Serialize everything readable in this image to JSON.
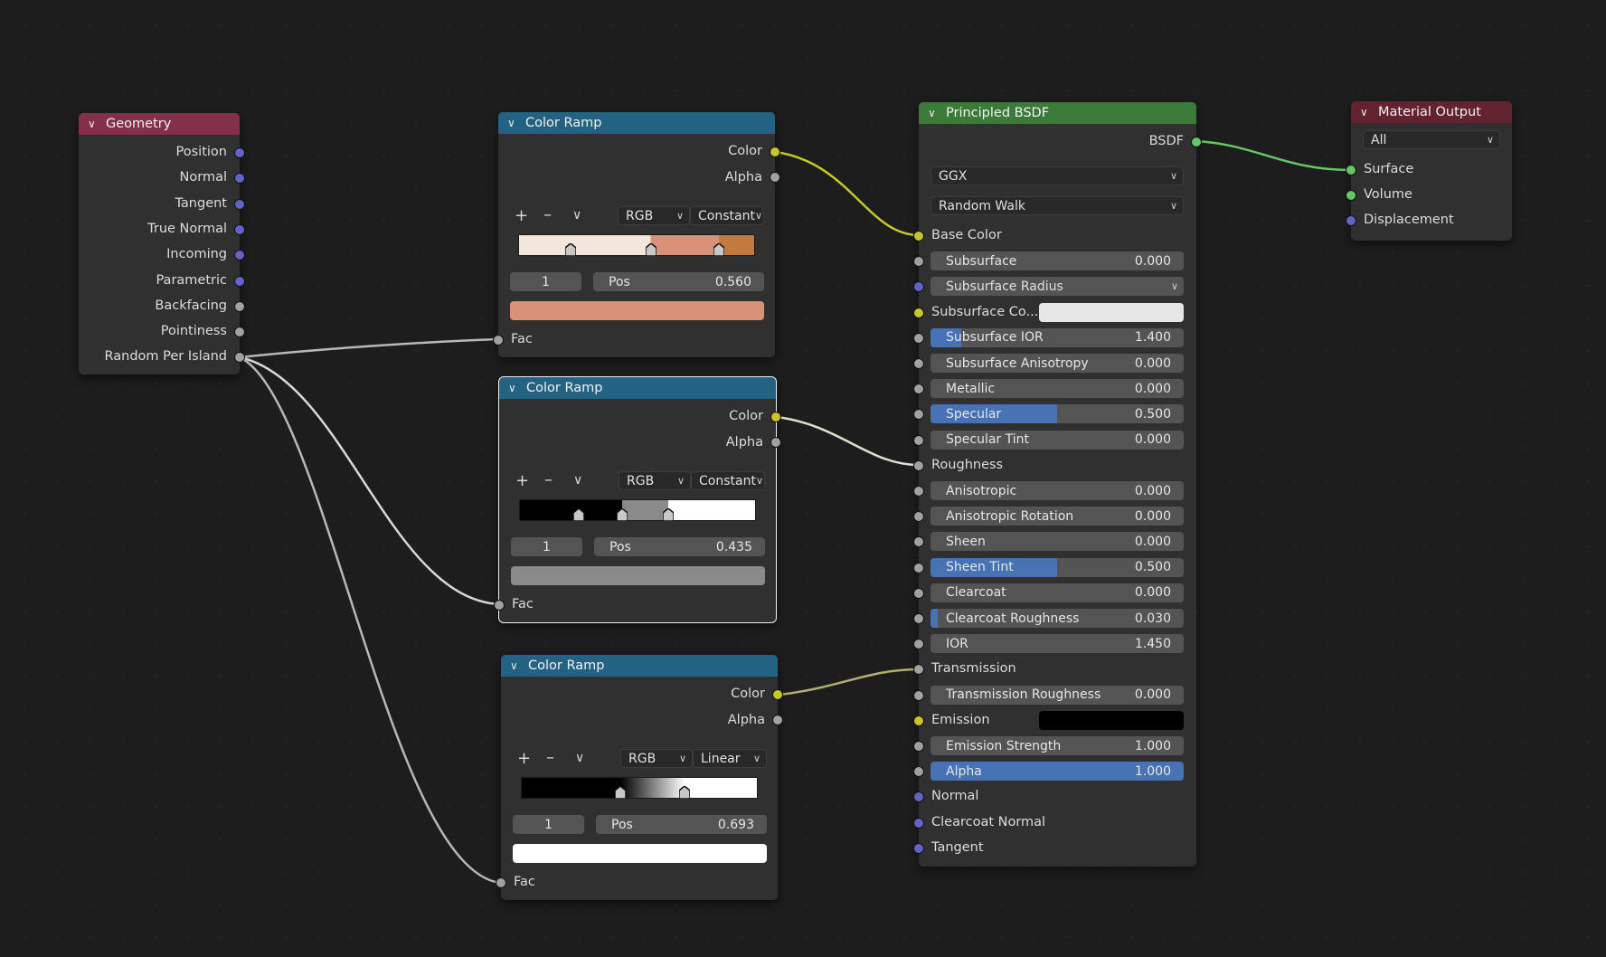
{
  "colors": {
    "socket_vector": "#6363c7",
    "socket_float": "#a1a1a1",
    "socket_color": "#c7c729",
    "socket_shader": "#63c763",
    "slider_fill": "#4772b3"
  },
  "geometry": {
    "title": "Geometry",
    "outputs": [
      "Position",
      "Normal",
      "Tangent",
      "True Normal",
      "Incoming",
      "Parametric",
      "Backfacing",
      "Pointiness",
      "Random Per Island"
    ]
  },
  "ramp1": {
    "title": "Color Ramp",
    "out_color": "Color",
    "out_alpha": "Alpha",
    "mode": "RGB",
    "interp": "Constant",
    "index": "1",
    "pos_label": "Pos",
    "pos": "0.560",
    "swatch": "#d9917a",
    "stops": [
      0.22,
      0.56,
      0.85
    ],
    "segments": [
      "#f3e6da",
      "#d9917a",
      "#c47a3f"
    ],
    "in_fac": "Fac"
  },
  "ramp2": {
    "title": "Color Ramp",
    "out_color": "Color",
    "out_alpha": "Alpha",
    "mode": "RGB",
    "interp": "Constant",
    "index": "1",
    "pos_label": "Pos",
    "pos": "0.435",
    "swatch": "#8a8a8a",
    "stops": [
      0.25,
      0.435,
      0.63
    ],
    "segments": [
      "#000000",
      "#8a8a8a",
      "#ffffff"
    ],
    "in_fac": "Fac"
  },
  "ramp3": {
    "title": "Color Ramp",
    "out_color": "Color",
    "out_alpha": "Alpha",
    "mode": "RGB",
    "interp": "Linear",
    "index": "1",
    "pos_label": "Pos",
    "pos": "0.693",
    "swatch": "#ffffff",
    "stops": [
      0.42,
      0.693
    ],
    "in_fac": "Fac"
  },
  "bsdf": {
    "title": "Principled BSDF",
    "out": "BSDF",
    "distribution": "GGX",
    "subsurface_method": "Random Walk",
    "base_color": "Base Color",
    "subsurface": {
      "label": "Subsurface",
      "value": "0.000",
      "fill": 0
    },
    "subsurface_radius": "Subsurface Radius",
    "subsurface_color": "Subsurface Co...",
    "subsurface_ior": {
      "label": "Subsurface IOR",
      "value": "1.400",
      "fill": 0.12
    },
    "subsurface_aniso": {
      "label": "Subsurface Anisotropy",
      "value": "0.000",
      "fill": 0
    },
    "metallic": {
      "label": "Metallic",
      "value": "0.000",
      "fill": 0
    },
    "specular": {
      "label": "Specular",
      "value": "0.500",
      "fill": 0.5
    },
    "specular_tint": {
      "label": "Specular Tint",
      "value": "0.000",
      "fill": 0
    },
    "roughness": "Roughness",
    "anisotropic": {
      "label": "Anisotropic",
      "value": "0.000",
      "fill": 0
    },
    "aniso_rot": {
      "label": "Anisotropic Rotation",
      "value": "0.000",
      "fill": 0
    },
    "sheen": {
      "label": "Sheen",
      "value": "0.000",
      "fill": 0
    },
    "sheen_tint": {
      "label": "Sheen Tint",
      "value": "0.500",
      "fill": 0.5
    },
    "clearcoat": {
      "label": "Clearcoat",
      "value": "0.000",
      "fill": 0
    },
    "clearcoat_rough": {
      "label": "Clearcoat Roughness",
      "value": "0.030",
      "fill": 0.03
    },
    "ior": {
      "label": "IOR",
      "value": "1.450",
      "fill": 0
    },
    "transmission": "Transmission",
    "trans_rough": {
      "label": "Transmission Roughness",
      "value": "0.000",
      "fill": 0
    },
    "emission": "Emission",
    "emission_strength": {
      "label": "Emission Strength",
      "value": "1.000",
      "fill": 0
    },
    "alpha": {
      "label": "Alpha",
      "value": "1.000",
      "fill": 1.0
    },
    "normal": "Normal",
    "clearcoat_normal": "Clearcoat Normal",
    "tangent": "Tangent"
  },
  "output": {
    "title": "Material Output",
    "target": "All",
    "inputs": [
      "Surface",
      "Volume",
      "Displacement"
    ]
  }
}
